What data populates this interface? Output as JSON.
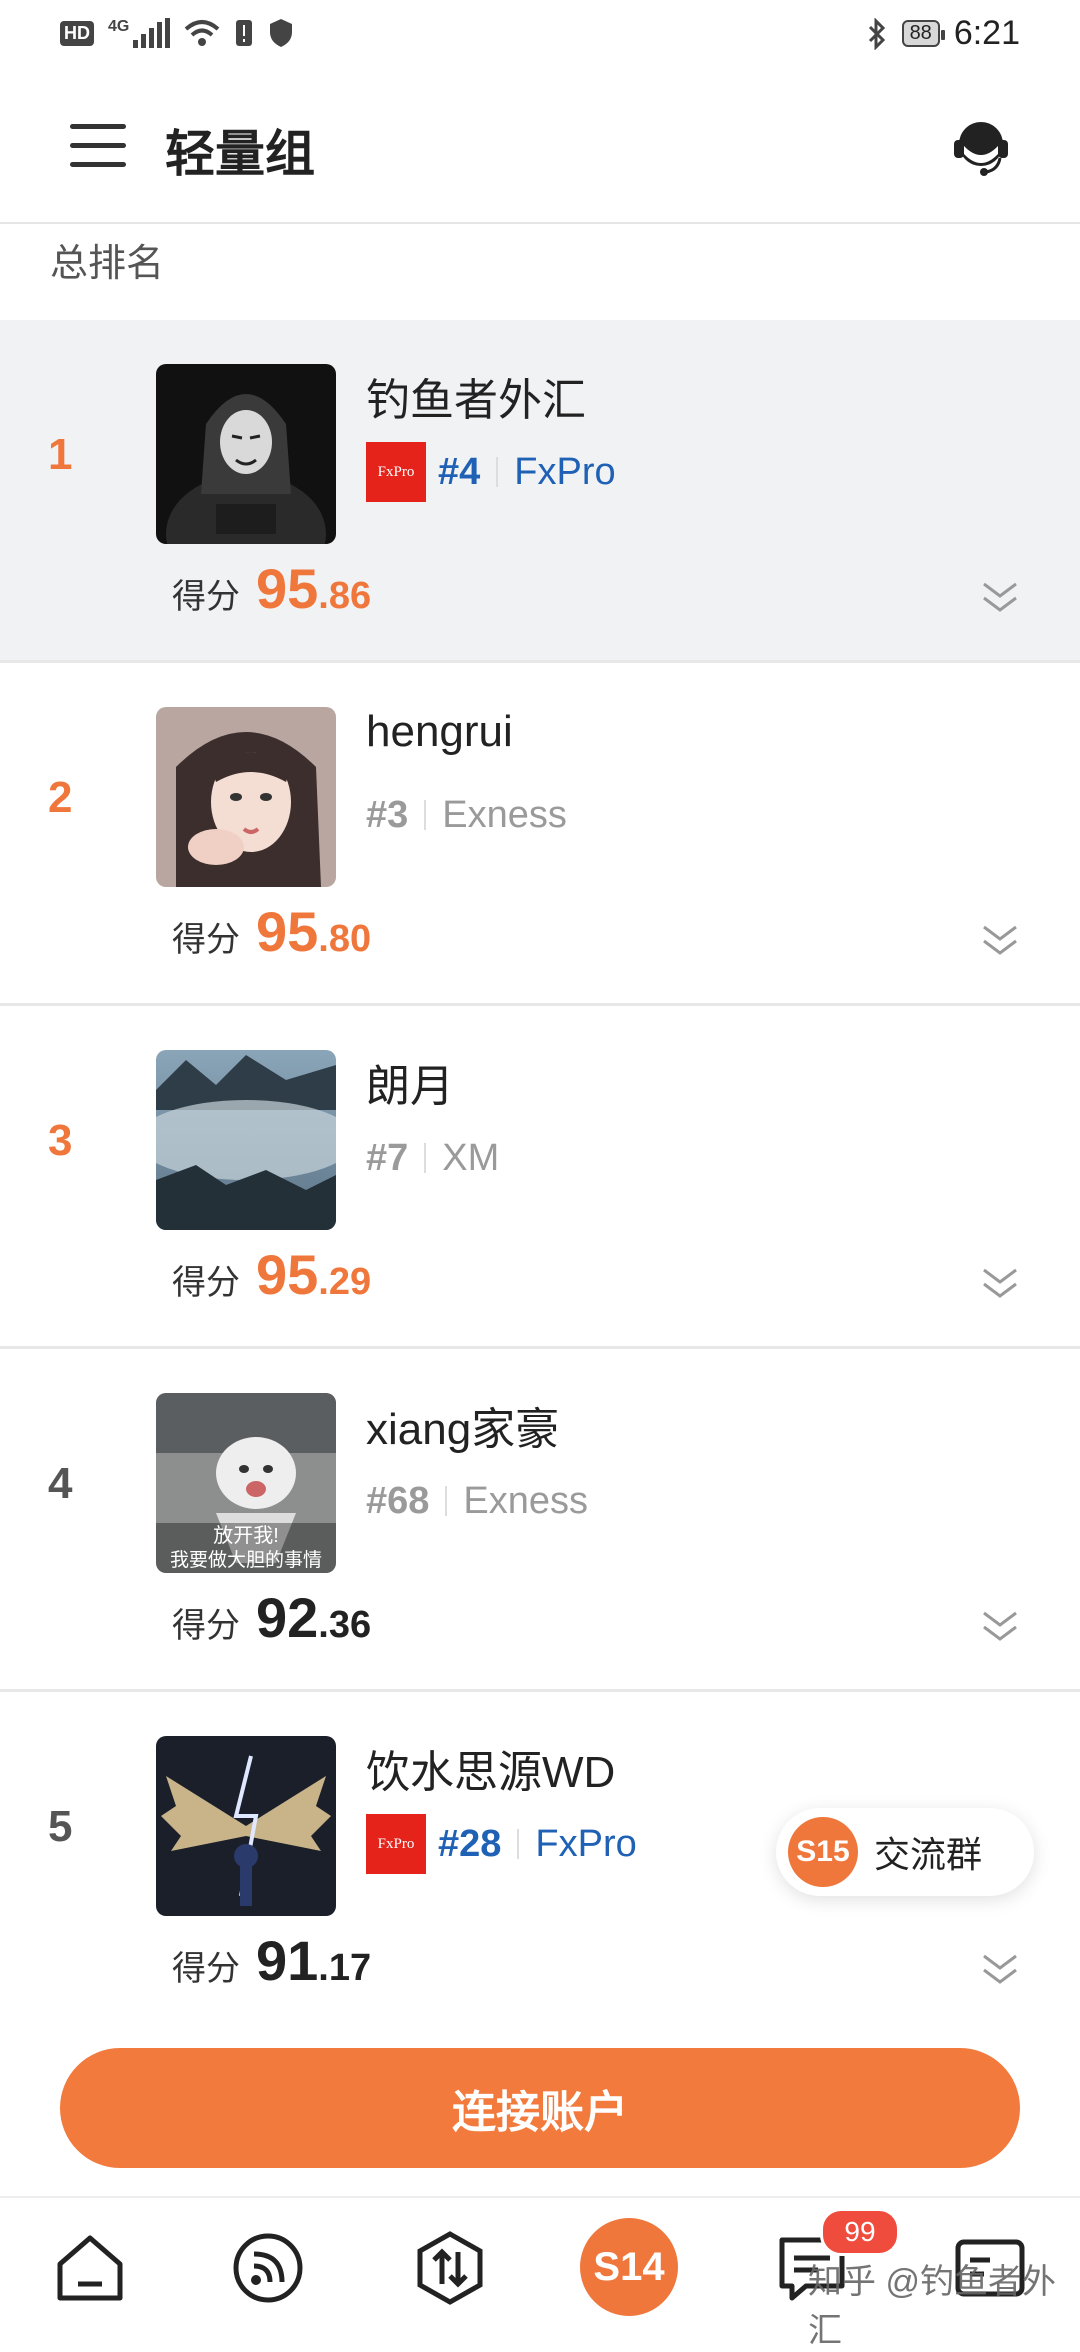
{
  "status_bar": {
    "left": {
      "hd": "HD",
      "network": "4G"
    },
    "right": {
      "battery": "88",
      "time": "6:21"
    }
  },
  "header": {
    "title": "轻量组",
    "menu_icon": "menu-icon",
    "support_icon": "headset-icon"
  },
  "section_title": "总排名",
  "rankings": [
    {
      "rank": "1",
      "name": "钓鱼者外汇",
      "broker_rank": "#4",
      "broker": "FxPro",
      "score_label": "得分",
      "score_int": "95",
      "score_dec": ".86",
      "logo_text": "FxPro"
    },
    {
      "rank": "2",
      "name": "hengrui",
      "broker_rank": "#3",
      "broker": "Exness",
      "score_label": "得分",
      "score_int": "95",
      "score_dec": ".80"
    },
    {
      "rank": "3",
      "name": "朗月",
      "broker_rank": "#7",
      "broker": "XM",
      "score_label": "得分",
      "score_int": "95",
      "score_dec": ".29"
    },
    {
      "rank": "4",
      "name": "xiang家豪",
      "broker_rank": "#68",
      "broker": "Exness",
      "score_label": "得分",
      "score_int": "92",
      "score_dec": ".36",
      "avatar_caption_1": "放开我!",
      "avatar_caption_2": "我要做大胆的事情"
    },
    {
      "rank": "5",
      "name": "饮水思源WD",
      "broker_rank": "#28",
      "broker": "FxPro",
      "score_label": "得分",
      "score_int": "91",
      "score_dec": ".17",
      "logo_text": "FxPro"
    }
  ],
  "floating_chip": {
    "badge": "S15",
    "label": "交流群"
  },
  "connect_button": "连接账户",
  "tabbar": {
    "center": "S14",
    "messages_badge": "99",
    "watermark": "知乎 @钓鱼者外汇"
  },
  "colors": {
    "accent": "#f0773c",
    "broker_blue": "#1f61b4",
    "muted": "#9a9a9a"
  }
}
